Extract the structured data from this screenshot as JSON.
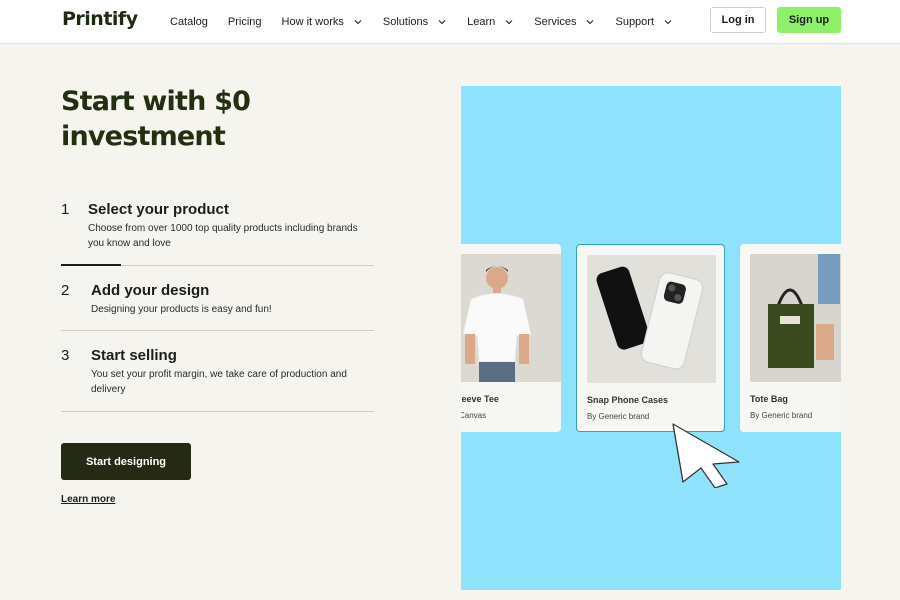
{
  "header": {
    "logo": "Printify",
    "nav": [
      {
        "label": "Catalog",
        "dropdown": false
      },
      {
        "label": "Pricing",
        "dropdown": false
      },
      {
        "label": "How it works",
        "dropdown": true
      },
      {
        "label": "Solutions",
        "dropdown": true
      },
      {
        "label": "Learn",
        "dropdown": true
      },
      {
        "label": "Services",
        "dropdown": true
      },
      {
        "label": "Support",
        "dropdown": true
      }
    ],
    "login_label": "Log in",
    "signup_label": "Sign up"
  },
  "hero": {
    "title_line1": "Start with $0",
    "title_line2": "investment"
  },
  "steps": [
    {
      "number": "1",
      "title": "Select your product",
      "description": "Choose from over 1000 top quality products including brands you know and love",
      "active": true
    },
    {
      "number": "2",
      "title": "Add your design",
      "description": "Designing your products is easy and fun!",
      "active": false
    },
    {
      "number": "3",
      "title": "Start selling",
      "description": "You set your profit margin, we take care of production and delivery",
      "active": false
    }
  ],
  "cta": {
    "start_label": "Start designing",
    "learn_more_label": "Learn more"
  },
  "products": [
    {
      "title": "leeve Tee",
      "brand": "Canvas",
      "selected": false
    },
    {
      "title": "Snap Phone Cases",
      "brand": "By Generic brand",
      "selected": true
    },
    {
      "title": "Tote Bag",
      "brand": "By Generic brand",
      "selected": false
    }
  ],
  "colors": {
    "accent_green": "#8ef06a",
    "dark_button": "#242a14",
    "panel_blue": "#8fe2fb",
    "page_bg": "#f5f4ef"
  }
}
